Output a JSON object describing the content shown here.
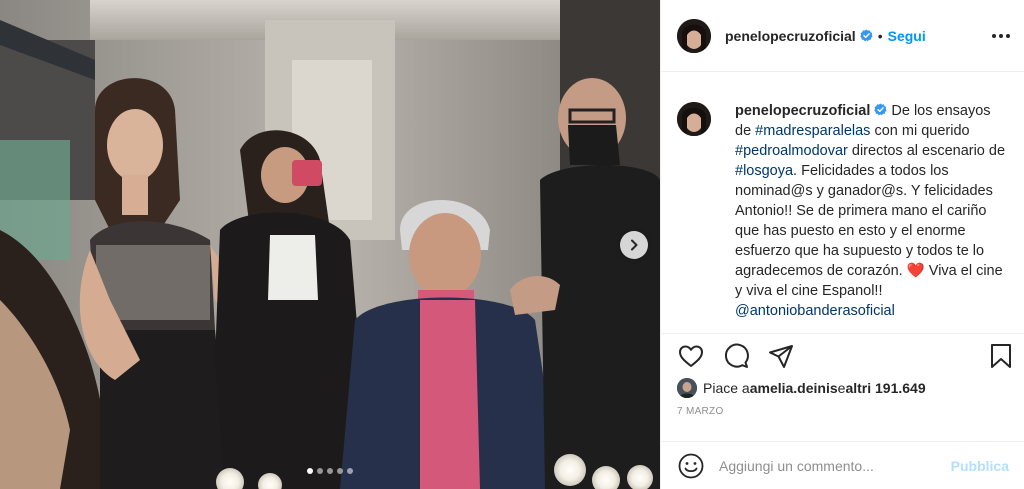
{
  "post": {
    "username": "penelopecruzoficial",
    "separator": "•",
    "follow_label": "Segui",
    "more_icon": "more-horizontal-icon",
    "caption": {
      "text_1": "De los ensayos de ",
      "tag_1": "#madresparalelas",
      "text_2": " con mi querido ",
      "tag_2": "#pedroalmodovar",
      "text_3": " directos al escenario de ",
      "tag_3": "#losgoya",
      "text_4": ". Felicidades a todos los nominad@s y ganador@s. Y felicidades Antonio!! Se de primera mano el cariño que has puesto en esto y el enorme esfuerzo que ha supuesto y todos te lo agradecemos de corazón. ",
      "heart": "❤️",
      "text_5": " Viva el cine y viva el cine Espanol!! ",
      "mention": "@antoniobanderasoficial"
    },
    "likes": {
      "prefix": "Piace a ",
      "user": "amelia.deinis",
      "middle": " e ",
      "others": "altri 191.649"
    },
    "date": "7 MARZO",
    "comment_input": {
      "placeholder": "Aggiungi un commento..."
    },
    "publish_label": "Pubblica",
    "carousel": {
      "slides": 5,
      "active": 0
    }
  },
  "colors": {
    "accent": "#0095f6",
    "link": "#00376b",
    "publish_disabled": "#b2dffc",
    "muted": "#8e8e8e",
    "verified": "#3897f0"
  }
}
